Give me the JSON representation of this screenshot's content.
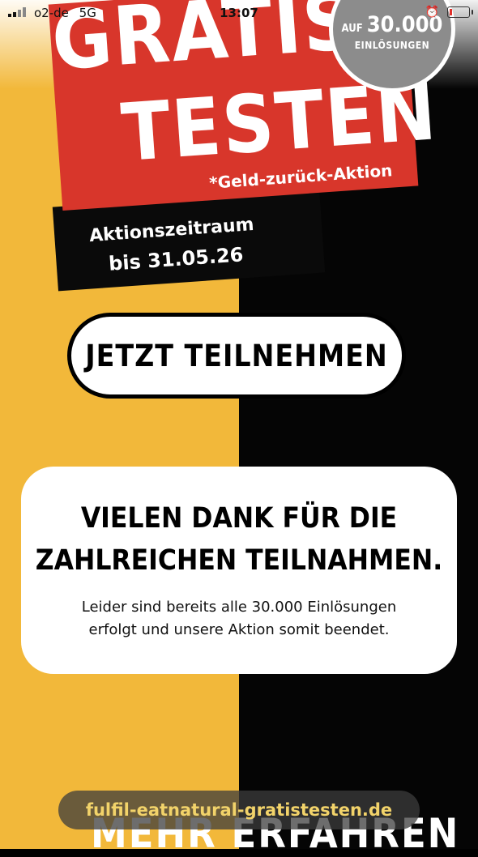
{
  "status_bar": {
    "carrier": "o2-de",
    "network": "5G",
    "time": "13:07"
  },
  "badge": {
    "prefix": "AUF",
    "number": "30.000",
    "label": "EINLÖSUNGEN"
  },
  "hero": {
    "line1": "GRATIS",
    "line2": "TESTEN",
    "star": "*",
    "subline": "*Geld-zurück-Aktion",
    "period_label": "Aktionszeitraum",
    "period_date": "bis 31.05.26"
  },
  "cta": {
    "label": "JETZT TEILNEHMEN"
  },
  "card": {
    "title_line1": "VIELEN DANK FÜR DIE",
    "title_line2": "ZAHLREICHEN TEILNAHMEN.",
    "text_line1": "Leider sind bereits alle 30.000 Einlösungen",
    "text_line2": "erfolgt und unsere Aktion somit beendet."
  },
  "footer": {
    "more_label": "MEHR ERFAHREN",
    "url": "fulfil-eatnatural-gratistesten.de"
  },
  "colors": {
    "yellow": "#f2b83a",
    "red": "#d8362b",
    "black": "#050505",
    "url_text": "#f2d36a"
  }
}
